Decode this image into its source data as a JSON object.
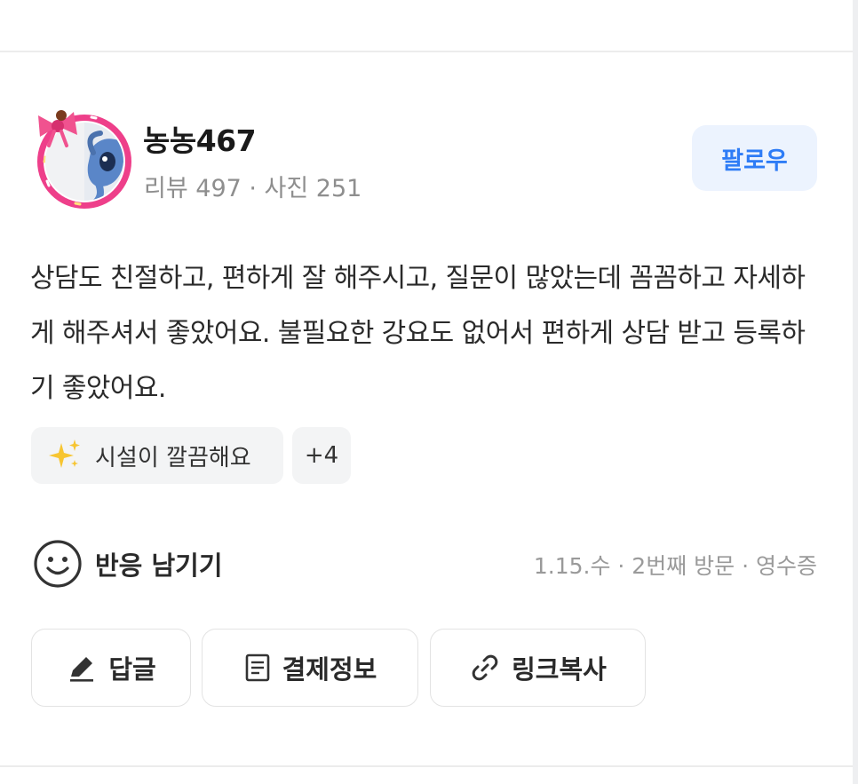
{
  "profile": {
    "username": "농농467",
    "stats": "리뷰 497 · 사진 251",
    "follow_label": "팔로우"
  },
  "review": {
    "text": "상담도 친절하고, 편하게 잘 해주시고, 질문이 많았는데 꼼꼼하고 자세하게 해주셔서 좋았어요. 불필요한 강요도 없어서 편하게 상담 받고 등록하기 좋았어요."
  },
  "tags": {
    "keyword": "시설이 깔끔해요",
    "more": "+4"
  },
  "reaction": {
    "label": "반응 남기기"
  },
  "meta": {
    "text": "1.15.수 · 2번째 방문 · 영수증"
  },
  "actions": {
    "reply": "답글",
    "payment_info": "결제정보",
    "copy_link": "링크복사"
  },
  "colors": {
    "accent": "#2e7cf6",
    "follow_bg": "#ecf3fe",
    "tag_bg": "#f3f4f5",
    "avatar_ring": "#ee3f8a"
  },
  "icons": {
    "avatar_decoration": "pink-bow-icon",
    "tag": "sparkles-icon",
    "reaction": "smile-icon",
    "reply": "pencil-icon",
    "payment": "receipt-icon",
    "link": "link-icon"
  }
}
